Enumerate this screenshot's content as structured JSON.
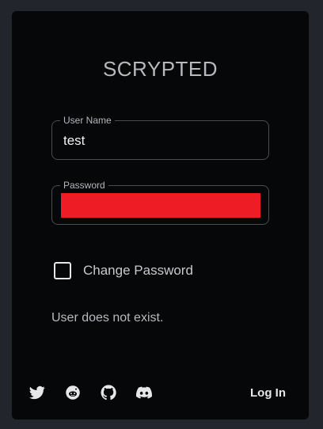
{
  "app": {
    "title": "SCRYPTED"
  },
  "form": {
    "username_label": "User Name",
    "username_value": "test",
    "password_label": "Password",
    "change_password_label": "Change Password",
    "change_password_checked": false,
    "error_message": "User does not exist."
  },
  "footer": {
    "icons": [
      "twitter-icon",
      "reddit-icon",
      "github-icon",
      "discord-icon"
    ],
    "login_label": "Log In"
  },
  "colors": {
    "background": "#22252b",
    "card": "#050709",
    "redaction": "#ee1c24"
  }
}
